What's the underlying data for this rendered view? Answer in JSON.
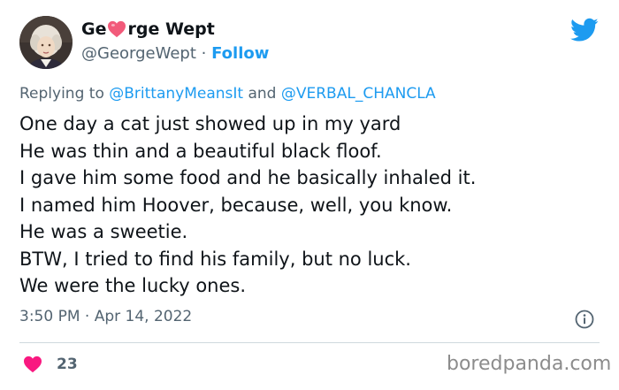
{
  "author": {
    "name_part1": "Ge",
    "name_part2": "rge Wept",
    "handle": "@GeorgeWept",
    "separator": " · ",
    "follow_label": "Follow"
  },
  "reply": {
    "prefix": "Replying to ",
    "mention1": "@BrittanyMeansIt",
    "conjunction": " and ",
    "mention2": "@VERBAL_CHANCLA"
  },
  "tweet": {
    "lines": [
      "One day a cat just showed up in my yard",
      "He was thin and a beautiful black floof.",
      "I gave him some food and he basically inhaled it.",
      "I named him Hoover, because, well, you know.",
      "He was a sweetie.",
      "BTW, I tried to find his family, but no luck.",
      "We were the lucky ones."
    ]
  },
  "meta": {
    "timestamp": "3:50 PM · Apr 14, 2022",
    "like_count": "23"
  },
  "watermark": "boredpanda.com",
  "colors": {
    "accent_blue": "#1d9bf0",
    "heart_pink": "#f91880",
    "muted_gray": "#536471",
    "text": "#0f1419",
    "divider": "#cfd9de"
  },
  "icons": {
    "name_emoji": "heart-emoji",
    "brand": "twitter-bird-icon",
    "info": "info-icon",
    "like": "heart-icon"
  }
}
